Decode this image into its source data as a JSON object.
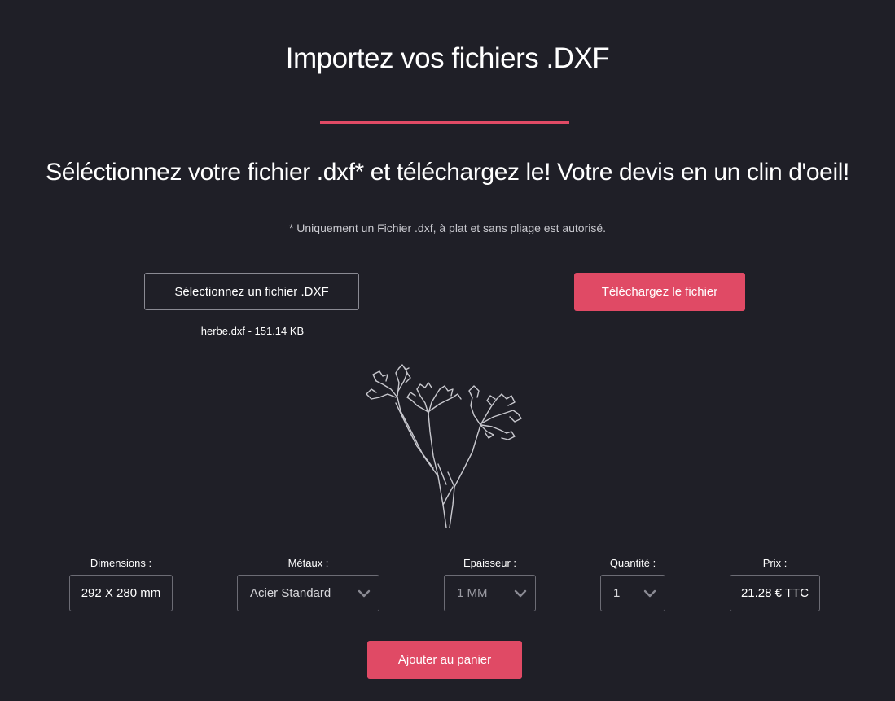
{
  "header": {
    "title": "Importez vos fichiers .DXF",
    "subtitle": "Séléctionnez votre fichier .dxf* et téléchargez le! Votre devis en un clin d'oeil!",
    "note": "* Uniquement un Fichier .dxf, à plat et sans pliage est autorisé.",
    "accent_color": "#e04a65"
  },
  "upload": {
    "select_label": "Sélectionnez un fichier .DXF",
    "upload_label": "Téléchargez le fichier",
    "file_name": "herbe.dxf - 151.14 KB"
  },
  "preview": {
    "icon": "plant-drawing-preview"
  },
  "options": {
    "dimensions": {
      "label": "Dimensions :",
      "value": "292 X 280 mm"
    },
    "metaux": {
      "label": "Métaux :",
      "value": "Acier Standard"
    },
    "epaisseur": {
      "label": "Epaisseur :",
      "value": "1 MM"
    },
    "quantite": {
      "label": "Quantité :",
      "value": "1"
    },
    "prix": {
      "label": "Prix :",
      "value": "21.28 € TTC"
    }
  },
  "cart": {
    "button_label": "Ajouter au panier"
  }
}
